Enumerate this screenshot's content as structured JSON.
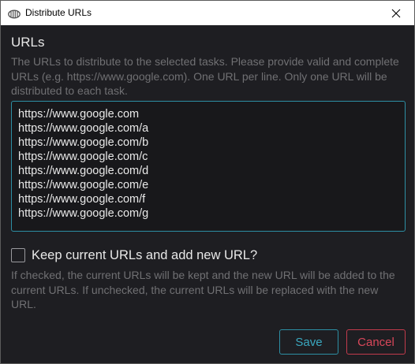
{
  "window": {
    "title": "Distribute URLs",
    "icon": "app-logo-icon",
    "close_icon": "close-icon"
  },
  "urls_section": {
    "title": "URLs",
    "help": "The URLs to distribute to the selected tasks. Please provide valid and complete URLs (e.g. https://www.google.com). One URL per line. Only one URL will be distributed to each task.",
    "value": "https://www.google.com\nhttps://www.google.com/a\nhttps://www.google.com/b\nhttps://www.google.com/c\nhttps://www.google.com/d\nhttps://www.google.com/e\nhttps://www.google.com/f\nhttps://www.google.com/g"
  },
  "keep_option": {
    "label": "Keep current URLs and add new URL?",
    "checked": false,
    "help": "If checked, the current URLs will be kept and the new URL will be added to the current URLs. If unchecked, the current URLs will be replaced with the new URL."
  },
  "actions": {
    "save_label": "Save",
    "cancel_label": "Cancel"
  },
  "colors": {
    "background": "#1e1e22",
    "accent": "#2d8fa4",
    "danger": "#c23b4c",
    "muted_text": "#707073"
  }
}
